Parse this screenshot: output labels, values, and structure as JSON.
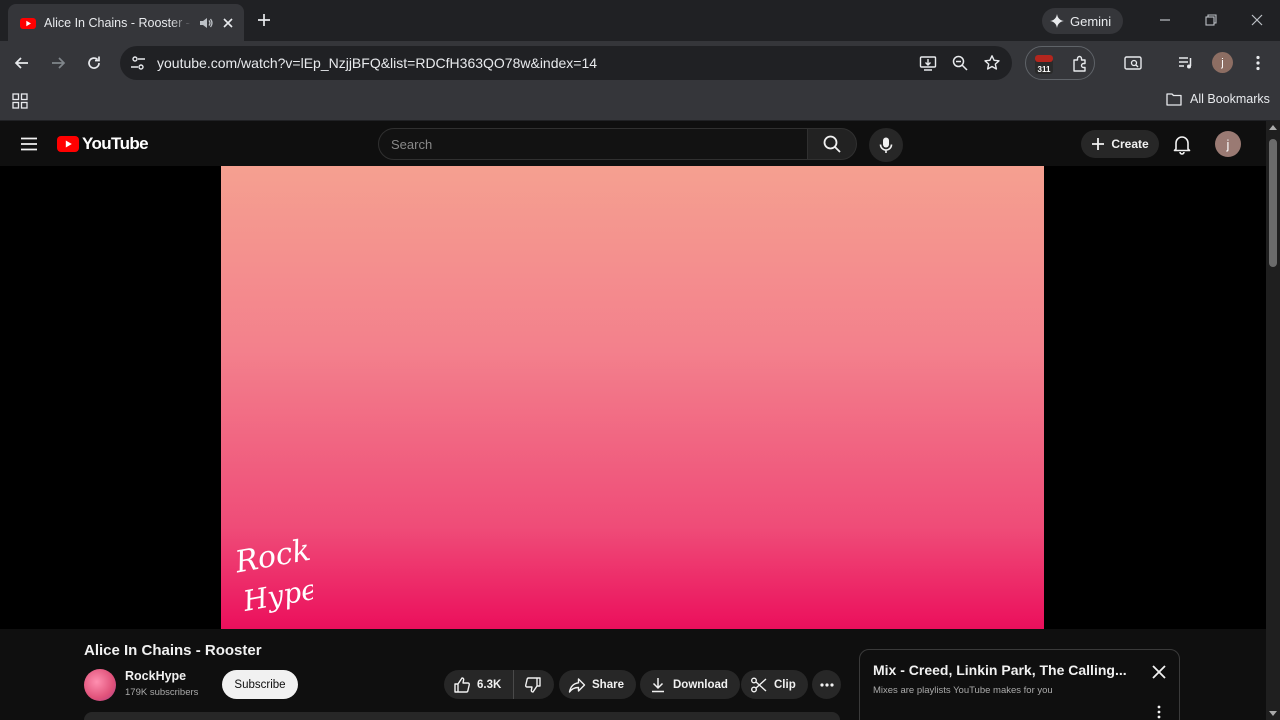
{
  "browser": {
    "tab": {
      "title": "Alice In Chains - Rooster - YouTube",
      "audio_icon": "speaker-icon",
      "close_icon": "close-icon"
    },
    "new_tab_icon": "plus-icon",
    "gemini_label": "Gemini",
    "address": {
      "url": "youtube.com/watch?v=lEp_NzjjBFQ&list=RDCfH363QO78w&index=14"
    },
    "extension_badge": "311",
    "profile_initial": "j",
    "bookmarks": {
      "all_label": "All Bookmarks"
    }
  },
  "youtube": {
    "logo_text": "YouTube",
    "search": {
      "placeholder": "Search"
    },
    "create_label": "Create",
    "avatar_initial": "j",
    "video": {
      "title": "Alice In Chains - Rooster",
      "watermark_text": "Rock Hype"
    },
    "channel": {
      "name": "RockHype",
      "subscribers": "179K subscribers",
      "subscribe_label": "Subscribe"
    },
    "actions": {
      "like_count": "6.3K",
      "share": "Share",
      "download": "Download",
      "clip": "Clip"
    },
    "mix": {
      "title": "Mix - Creed, Linkin Park, The Calling...",
      "subtitle": "Mixes are playlists YouTube makes for you"
    }
  },
  "colors": {
    "youtube_red": "#ff0000",
    "video_gradient_top": "#f5a090",
    "video_gradient_bottom": "#eb0f5c"
  }
}
